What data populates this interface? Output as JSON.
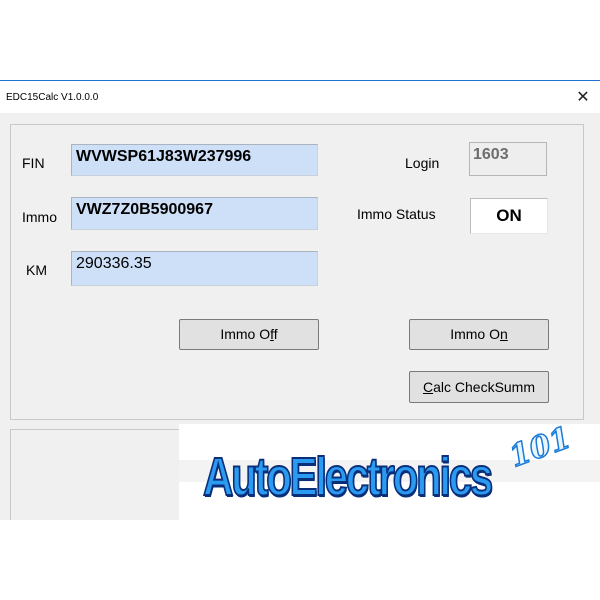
{
  "window": {
    "title": "EDC15Calc V1.0.0.0",
    "close_glyph": "✕"
  },
  "fields": {
    "fin_label": "FIN",
    "fin_value": "WVWSP61J83W237996",
    "immo_label": "Immo",
    "immo_value": "VWZ7Z0B5900967",
    "km_label": "KM",
    "km_value": "290336.35",
    "login_label": "Login",
    "login_value": "1603",
    "immo_status_label": "Immo Status",
    "immo_status_value": "ON"
  },
  "buttons": {
    "immo_off": {
      "pre": "Immo O",
      "accel": "f",
      "post": "f"
    },
    "immo_on": {
      "pre": "Immo O",
      "accel": "n",
      "post": ""
    },
    "calc_checksum": {
      "pre": "",
      "accel": "C",
      "post": "alc CheckSumm"
    }
  },
  "banner": {
    "logo_text": "AutoElectronics",
    "logo_mark": "101"
  },
  "icons": {
    "close": "close-icon"
  },
  "colors": {
    "window_bg": "#f0f0f0",
    "field_bg": "#cde0f7",
    "title_accent": "#1e74d0",
    "logo_fill": "#2a9bf0",
    "logo_outline": "#0a2f7a"
  }
}
